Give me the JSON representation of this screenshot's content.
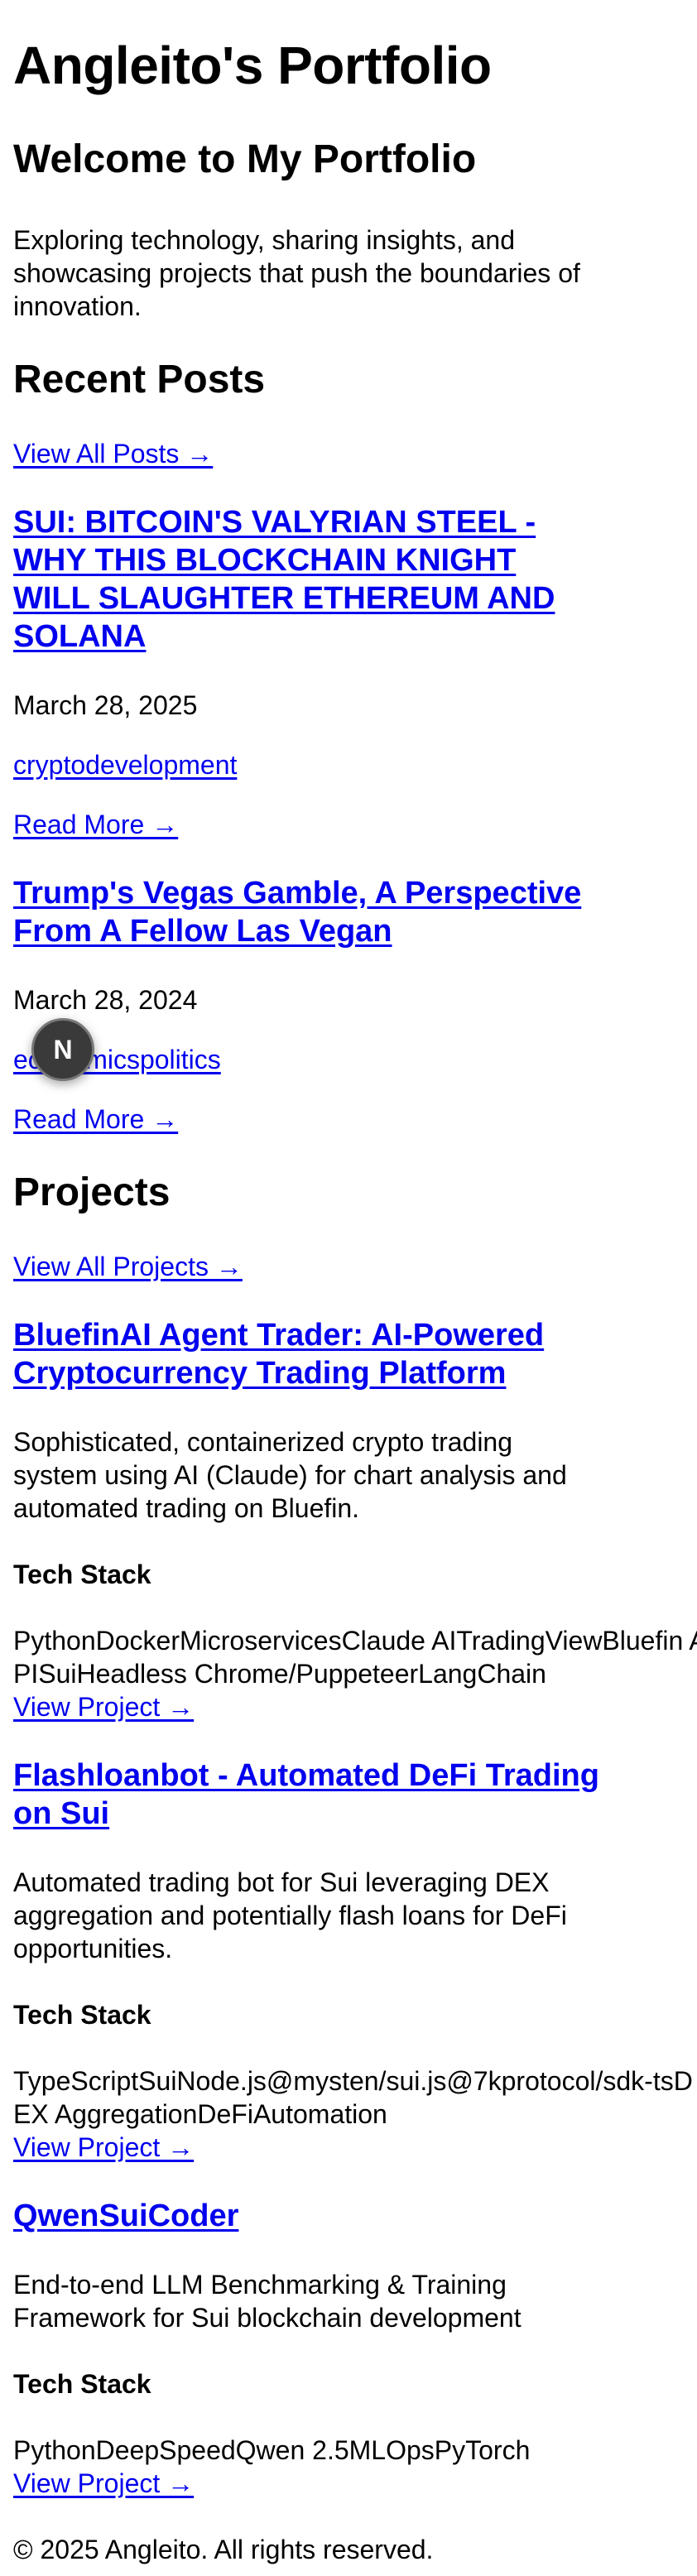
{
  "site": {
    "title": "Angleito's Portfolio"
  },
  "welcome": {
    "heading": "Welcome to My Portfolio",
    "intro": "Exploring technology, sharing insights, and showcasing projects that push the boundaries of innovation."
  },
  "posts": {
    "heading": "Recent Posts",
    "view_all": "View All Posts →",
    "items": [
      {
        "title": "SUI: BITCOIN'S VALYRIAN STEEL - WHY THIS BLOCKCHAIN KNIGHT WILL SLAUGHTER ETHEREUM AND SOLANA",
        "date": "March 28, 2025",
        "tags": "cryptodevelopment",
        "read_more": "Read More →"
      },
      {
        "title": "Trump's Vegas Gamble, A Perspective From A Fellow Las Vegan",
        "date": "March 28, 2024",
        "tags": "economicspolitics",
        "read_more": "Read More →"
      }
    ]
  },
  "projects": {
    "heading": "Projects",
    "view_all": "View All Projects →",
    "tech_heading": "Tech Stack",
    "items": [
      {
        "title": "BluefinAI Agent Trader: AI-Powered Cryptocurrency Trading Platform",
        "description": "Sophisticated, containerized crypto trading system using AI (Claude) for chart analysis and automated trading on Bluefin.",
        "tech": [
          "Python",
          "Docker",
          "Microservices",
          "Claude AI",
          "TradingView",
          "Bluefin API",
          "Sui",
          "Headless Chrome/Puppeteer",
          "LangChain"
        ],
        "link": "View Project →"
      },
      {
        "title": "Flashloanbot - Automated DeFi Trading on Sui",
        "description": "Automated trading bot for Sui leveraging DEX aggregation and potentially flash loans for DeFi opportunities.",
        "tech": [
          "TypeScript",
          "Sui",
          "Node.js",
          "@mysten/sui.js",
          "@7kprotocol/sdk-ts",
          "DEX Aggregation",
          "DeFi",
          "Automation"
        ],
        "link": "View Project →"
      },
      {
        "title": "QwenSuiCoder",
        "description": "End-to-end LLM Benchmarking & Training Framework for Sui blockchain development",
        "tech": [
          "Python",
          "DeepSpeed",
          "Qwen 2.5",
          "MLOps",
          "PyTorch"
        ],
        "link": "View Project →"
      }
    ]
  },
  "footer": {
    "text": "© 2025 Angleito. All rights reserved."
  },
  "dev_badge": {
    "letter": "N"
  }
}
